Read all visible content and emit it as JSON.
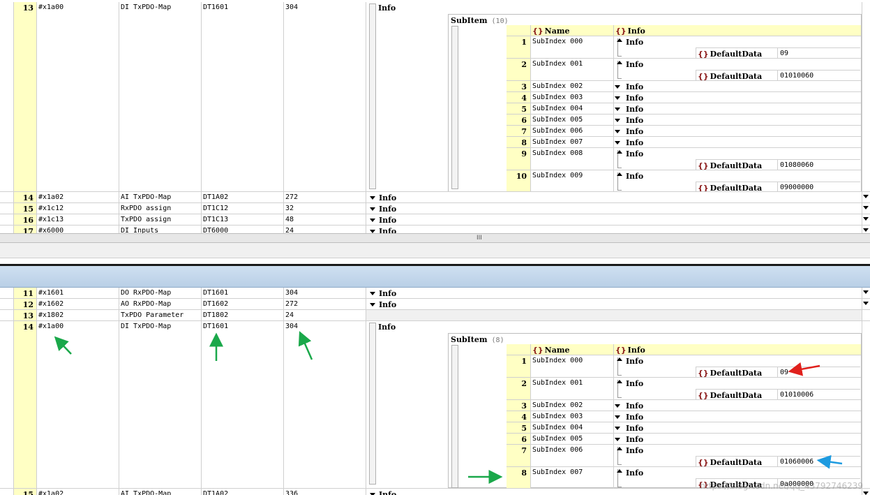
{
  "top": {
    "rows": [
      {
        "num": "13",
        "index": "#x1a00",
        "name": "DI TxPDO-Map",
        "type": "DT1601",
        "bits": "304",
        "info": "Info"
      },
      {
        "num": "14",
        "index": "#x1a02",
        "name": "AI TxPDO-Map",
        "type": "DT1A02",
        "bits": "272",
        "info": "Info"
      },
      {
        "num": "15",
        "index": "#x1c12",
        "name": "RxPDO assign",
        "type": "DT1C12",
        "bits": "32",
        "info": "Info"
      },
      {
        "num": "16",
        "index": "#x1c13",
        "name": "TxPDO assign",
        "type": "DT1C13",
        "bits": "48",
        "info": "Info"
      },
      {
        "num": "17",
        "index": "#x6000",
        "name": "DI Inputs",
        "type": "DT6000",
        "bits": "24",
        "info": "Info"
      }
    ],
    "subgrid": {
      "title": "SubItem",
      "count": "(10)",
      "col_name": "Name",
      "col_info": "Info",
      "items": [
        {
          "num": "1",
          "name": "SubIndex 000",
          "info": "Info",
          "key": "DefaultData",
          "value": "09"
        },
        {
          "num": "2",
          "name": "SubIndex 001",
          "info": "Info",
          "key": "DefaultData",
          "value": "01010060"
        },
        {
          "num": "3",
          "name": "SubIndex 002",
          "info": "Info"
        },
        {
          "num": "4",
          "name": "SubIndex 003",
          "info": "Info"
        },
        {
          "num": "5",
          "name": "SubIndex 004",
          "info": "Info"
        },
        {
          "num": "6",
          "name": "SubIndex 005",
          "info": "Info"
        },
        {
          "num": "7",
          "name": "SubIndex 006",
          "info": "Info"
        },
        {
          "num": "8",
          "name": "SubIndex 007",
          "info": "Info"
        },
        {
          "num": "9",
          "name": "SubIndex 008",
          "info": "Info",
          "key": "DefaultData",
          "value": "01080060"
        },
        {
          "num": "10",
          "name": "SubIndex 009",
          "info": "Info",
          "key": "DefaultData",
          "value": "09000000"
        }
      ]
    }
  },
  "splitter_grip": "III",
  "bottom": {
    "rows": [
      {
        "num": "11",
        "index": "#x1601",
        "name": "DO RxPDO-Map",
        "type": "DT1601",
        "bits": "304",
        "info": "Info"
      },
      {
        "num": "12",
        "index": "#x1602",
        "name": "AO RxPDO-Map",
        "type": "DT1602",
        "bits": "272",
        "info": "Info"
      },
      {
        "num": "13",
        "index": "#x1802",
        "name": "TxPDO Parameter",
        "type": "DT1802",
        "bits": "24",
        "info": ""
      },
      {
        "num": "14",
        "index": "#x1a00",
        "name": "DI TxPDO-Map",
        "type": "DT1601",
        "bits": "304",
        "info": "Info"
      },
      {
        "num": "15",
        "index": "#x1a02",
        "name": "AI TxPDO-Map",
        "type": "DT1A02",
        "bits": "336",
        "info": "Info"
      }
    ],
    "subgrid": {
      "title": "SubItem",
      "count": "(8)",
      "col_name": "Name",
      "col_info": "Info",
      "items": [
        {
          "num": "1",
          "name": "SubIndex 000",
          "info": "Info",
          "key": "DefaultData",
          "value": "09"
        },
        {
          "num": "2",
          "name": "SubIndex 001",
          "info": "Info",
          "key": "DefaultData",
          "value": "01010006"
        },
        {
          "num": "3",
          "name": "SubIndex 002",
          "info": "Info"
        },
        {
          "num": "4",
          "name": "SubIndex 003",
          "info": "Info"
        },
        {
          "num": "5",
          "name": "SubIndex 004",
          "info": "Info"
        },
        {
          "num": "6",
          "name": "SubIndex 005",
          "info": "Info"
        },
        {
          "num": "7",
          "name": "SubIndex 006",
          "info": "Info",
          "key": "DefaultData",
          "value": "01060006"
        },
        {
          "num": "8",
          "name": "SubIndex 007",
          "info": "Info",
          "key": "DefaultData",
          "value": "0a000000"
        }
      ]
    }
  },
  "watermark": "https://blog.csdn.net/qq_43792746239",
  "colors": {
    "arrow_green": "#1aa84a",
    "arrow_red": "#e0201c",
    "arrow_blue": "#1e9be0",
    "row_header": "#ffffc4",
    "brace": "#8b1a1a"
  }
}
